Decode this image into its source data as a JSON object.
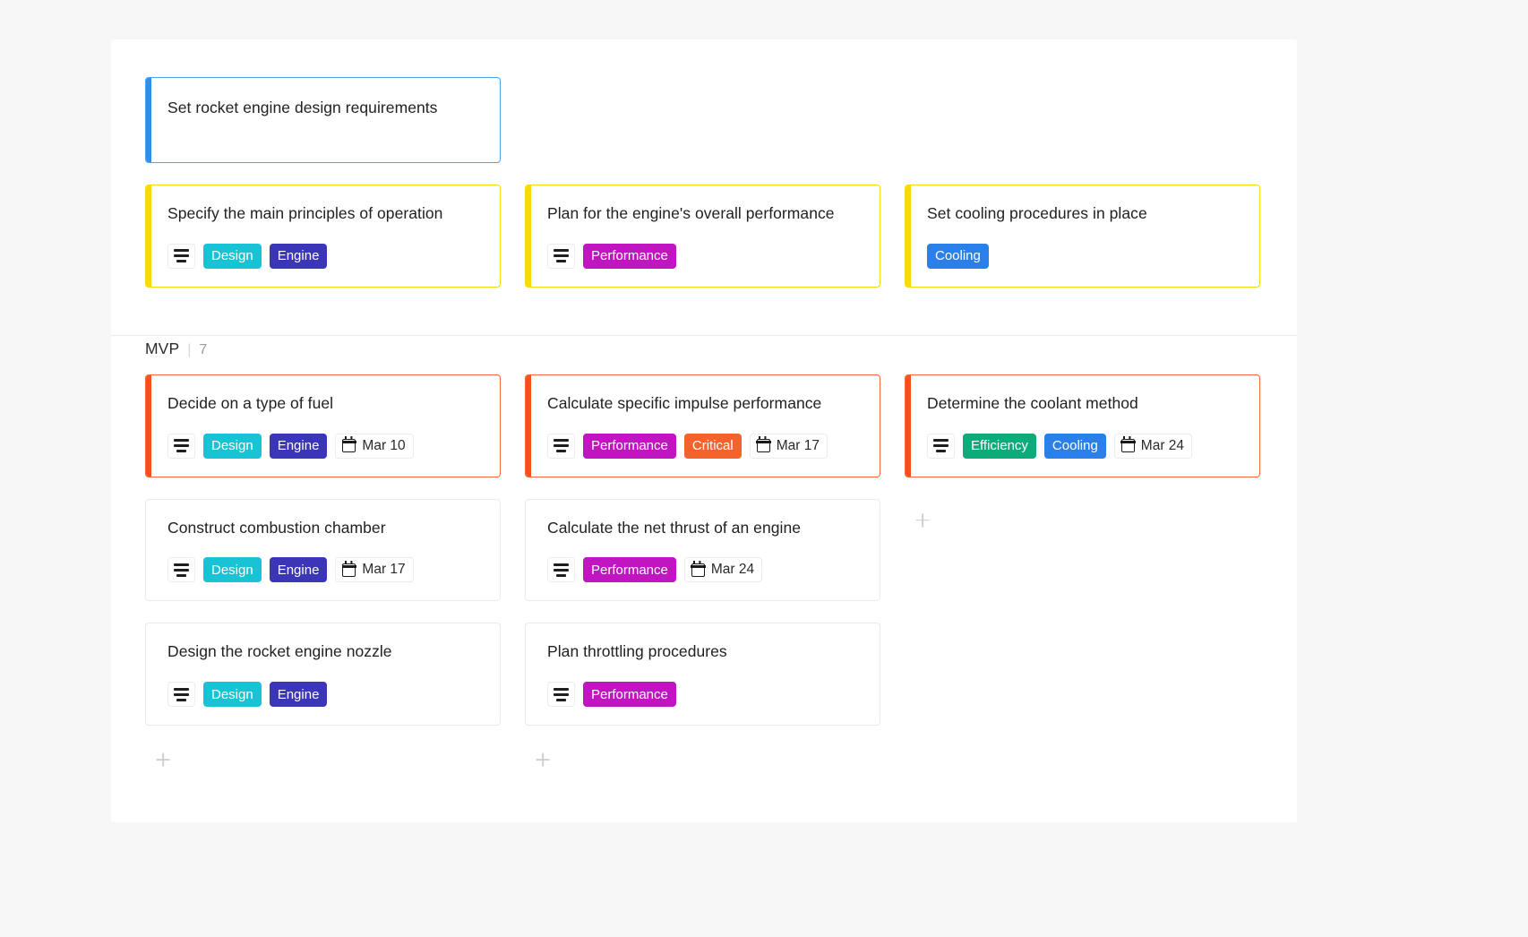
{
  "board": {
    "sections": [
      {
        "name": "top-section",
        "title": "",
        "count": "",
        "lead_card": {
          "title": "Set rocket engine design requirements",
          "accent": "blue",
          "has_description": false,
          "tags": [],
          "date": ""
        },
        "cards": [
          {
            "title": "Specify the main principles of operation",
            "accent": "yellow",
            "has_description": true,
            "tags": [
              {
                "label": "Design",
                "color": "#17c3d4"
              },
              {
                "label": "Engine",
                "color": "#3b35b8"
              }
            ],
            "date": ""
          },
          {
            "title": "Plan for the engine's overall performance",
            "accent": "yellow",
            "has_description": true,
            "tags": [
              {
                "label": "Performance",
                "color": "#c215c2"
              }
            ],
            "date": ""
          },
          {
            "title": "Set cooling procedures in place",
            "accent": "yellow",
            "has_description": false,
            "tags": [
              {
                "label": "Cooling",
                "color": "#2a7fe8"
              }
            ],
            "date": ""
          }
        ]
      },
      {
        "name": "mvp-section",
        "title": "MVP",
        "separator": "|",
        "count": "7",
        "columns": [
          {
            "cards": [
              {
                "title": "Decide on a type of fuel",
                "accent": "orange",
                "has_description": true,
                "tags": [
                  {
                    "label": "Design",
                    "color": "#17c3d4"
                  },
                  {
                    "label": "Engine",
                    "color": "#3b35b8"
                  }
                ],
                "date": "Mar 10"
              },
              {
                "title": "Construct combustion chamber",
                "accent": "none",
                "has_description": true,
                "tags": [
                  {
                    "label": "Design",
                    "color": "#17c3d4"
                  },
                  {
                    "label": "Engine",
                    "color": "#3b35b8"
                  }
                ],
                "date": "Mar 17"
              },
              {
                "title": "Design the rocket engine nozzle",
                "accent": "none",
                "has_description": true,
                "tags": [
                  {
                    "label": "Design",
                    "color": "#17c3d4"
                  },
                  {
                    "label": "Engine",
                    "color": "#3b35b8"
                  }
                ],
                "date": ""
              }
            ],
            "add_label": "+"
          },
          {
            "cards": [
              {
                "title": "Calculate specific impulse performance",
                "accent": "orange",
                "has_description": true,
                "tags": [
                  {
                    "label": "Performance",
                    "color": "#c215c2"
                  },
                  {
                    "label": "Critical",
                    "color": "#f4632b"
                  }
                ],
                "date": "Mar 17"
              },
              {
                "title": "Calculate the net thrust of an engine",
                "accent": "none",
                "has_description": true,
                "tags": [
                  {
                    "label": "Performance",
                    "color": "#c215c2"
                  }
                ],
                "date": "Mar 24"
              },
              {
                "title": "Plan throttling procedures",
                "accent": "none",
                "has_description": true,
                "tags": [
                  {
                    "label": "Performance",
                    "color": "#c215c2"
                  }
                ],
                "date": ""
              }
            ],
            "add_label": "+"
          },
          {
            "cards": [
              {
                "title": "Determine the coolant method",
                "accent": "orange",
                "has_description": true,
                "tags": [
                  {
                    "label": "Efficiency",
                    "color": "#0daa7a"
                  },
                  {
                    "label": "Cooling",
                    "color": "#2a7fe8"
                  }
                ],
                "date": "Mar 24"
              }
            ],
            "add_label": "+"
          }
        ]
      }
    ]
  }
}
